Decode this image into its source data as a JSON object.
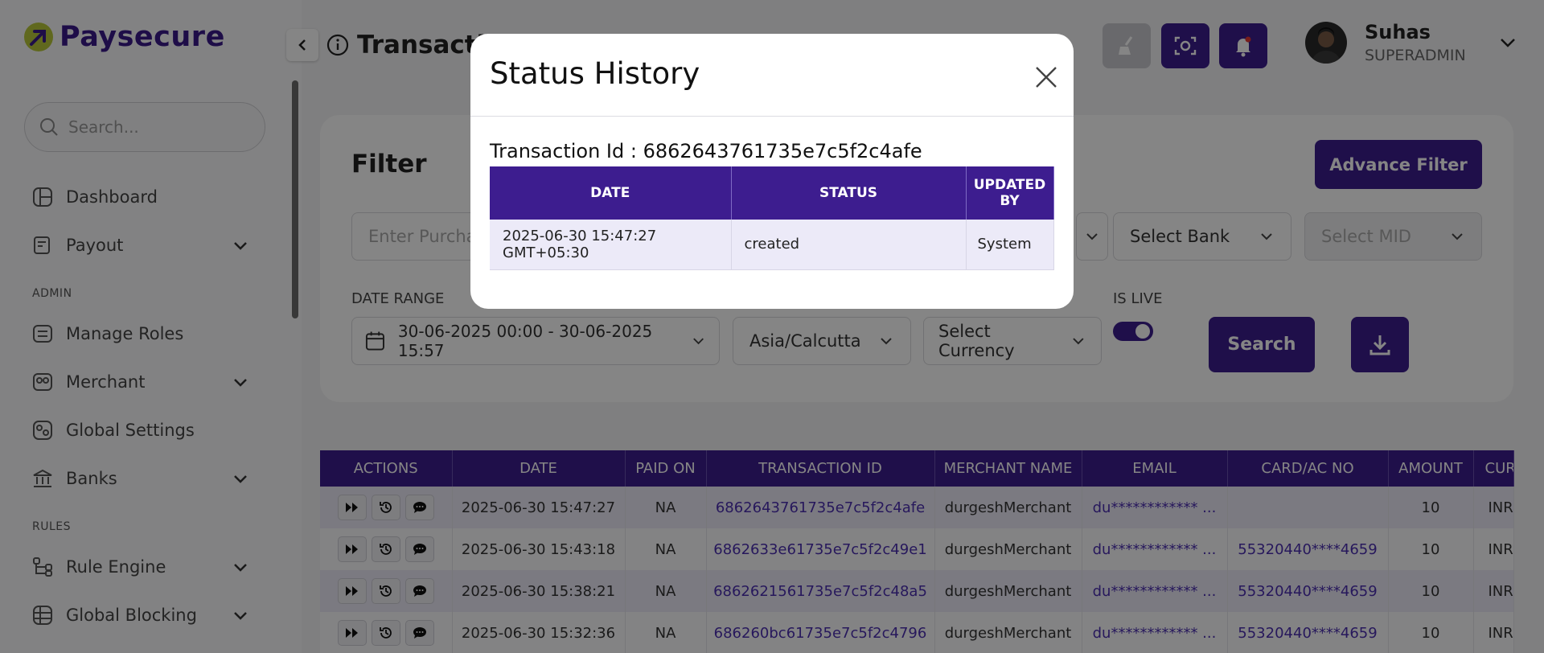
{
  "brand": {
    "name": "Paysecure",
    "accent": "#3d1d8f",
    "logo_dot": "#b8c83a"
  },
  "sidebar": {
    "search_placeholder": "Search...",
    "sections": {
      "admin": "ADMIN",
      "rules": "RULES"
    },
    "items": [
      {
        "label": "Dashboard",
        "icon": "dashboard-icon"
      },
      {
        "label": "Payout",
        "icon": "payout-icon"
      },
      {
        "label": "Manage Roles",
        "icon": "roles-icon"
      },
      {
        "label": "Merchant",
        "icon": "merchant-icon"
      },
      {
        "label": "Global Settings",
        "icon": "settings-icon"
      },
      {
        "label": "Banks",
        "icon": "bank-icon"
      },
      {
        "label": "Rule Engine",
        "icon": "rule-engine-icon"
      },
      {
        "label": "Global Blocking",
        "icon": "blocking-icon"
      }
    ]
  },
  "header": {
    "title": "Transactions",
    "user": {
      "name": "Suhas",
      "role": "SUPERADMIN"
    }
  },
  "filter": {
    "title": "Filter",
    "advance_filter_label": "Advance Filter",
    "purchase_placeholder": "Enter Purchase Id",
    "bank_placeholder": "Select Bank",
    "mid_placeholder": "Select MID",
    "date_range_label": "DATE RANGE",
    "date_range_value": "30-06-2025 00:00 - 30-06-2025 15:57",
    "timezone_value": "Asia/Calcutta",
    "currency_placeholder": "Select Currency",
    "is_live_label": "IS LIVE",
    "search_label": "Search"
  },
  "table": {
    "columns": [
      "ACTIONS",
      "DATE",
      "PAID ON",
      "TRANSACTION ID",
      "MERCHANT NAME",
      "EMAIL",
      "CARD/AC NO",
      "AMOUNT",
      "CURRENCY"
    ],
    "rows": [
      {
        "date": "2025-06-30 15:47:27",
        "paid_on": "NA",
        "txid": "6862643761735e7c5f2c4afe",
        "merchant": "durgeshMerchant",
        "email": "du************ ...",
        "card": "",
        "amount": "10",
        "currency": "INR"
      },
      {
        "date": "2025-06-30 15:43:18",
        "paid_on": "NA",
        "txid": "6862633e61735e7c5f2c49e1",
        "merchant": "durgeshMerchant",
        "email": "du************ ...",
        "card": "55320440****4659",
        "amount": "10",
        "currency": "INR"
      },
      {
        "date": "2025-06-30 15:38:21",
        "paid_on": "NA",
        "txid": "6862621561735e7c5f2c48a5",
        "merchant": "durgeshMerchant",
        "email": "du************ ...",
        "card": "55320440****4659",
        "amount": "10",
        "currency": "INR"
      },
      {
        "date": "2025-06-30 15:32:36",
        "paid_on": "NA",
        "txid": "686260bc61735e7c5f2c4796",
        "merchant": "durgeshMerchant",
        "email": "du************ ...",
        "card": "55320440****4659",
        "amount": "10",
        "currency": "INR"
      }
    ]
  },
  "modal": {
    "title": "Status History",
    "transaction_label": "Transaction Id : 6862643761735e7c5f2c4afe",
    "columns": [
      "DATE",
      "STATUS",
      "UPDATED BY"
    ],
    "rows": [
      {
        "date_line1": "2025-06-30 15:47:27",
        "date_line2": "GMT+05:30",
        "status": "created",
        "updated_by": "System"
      }
    ]
  }
}
